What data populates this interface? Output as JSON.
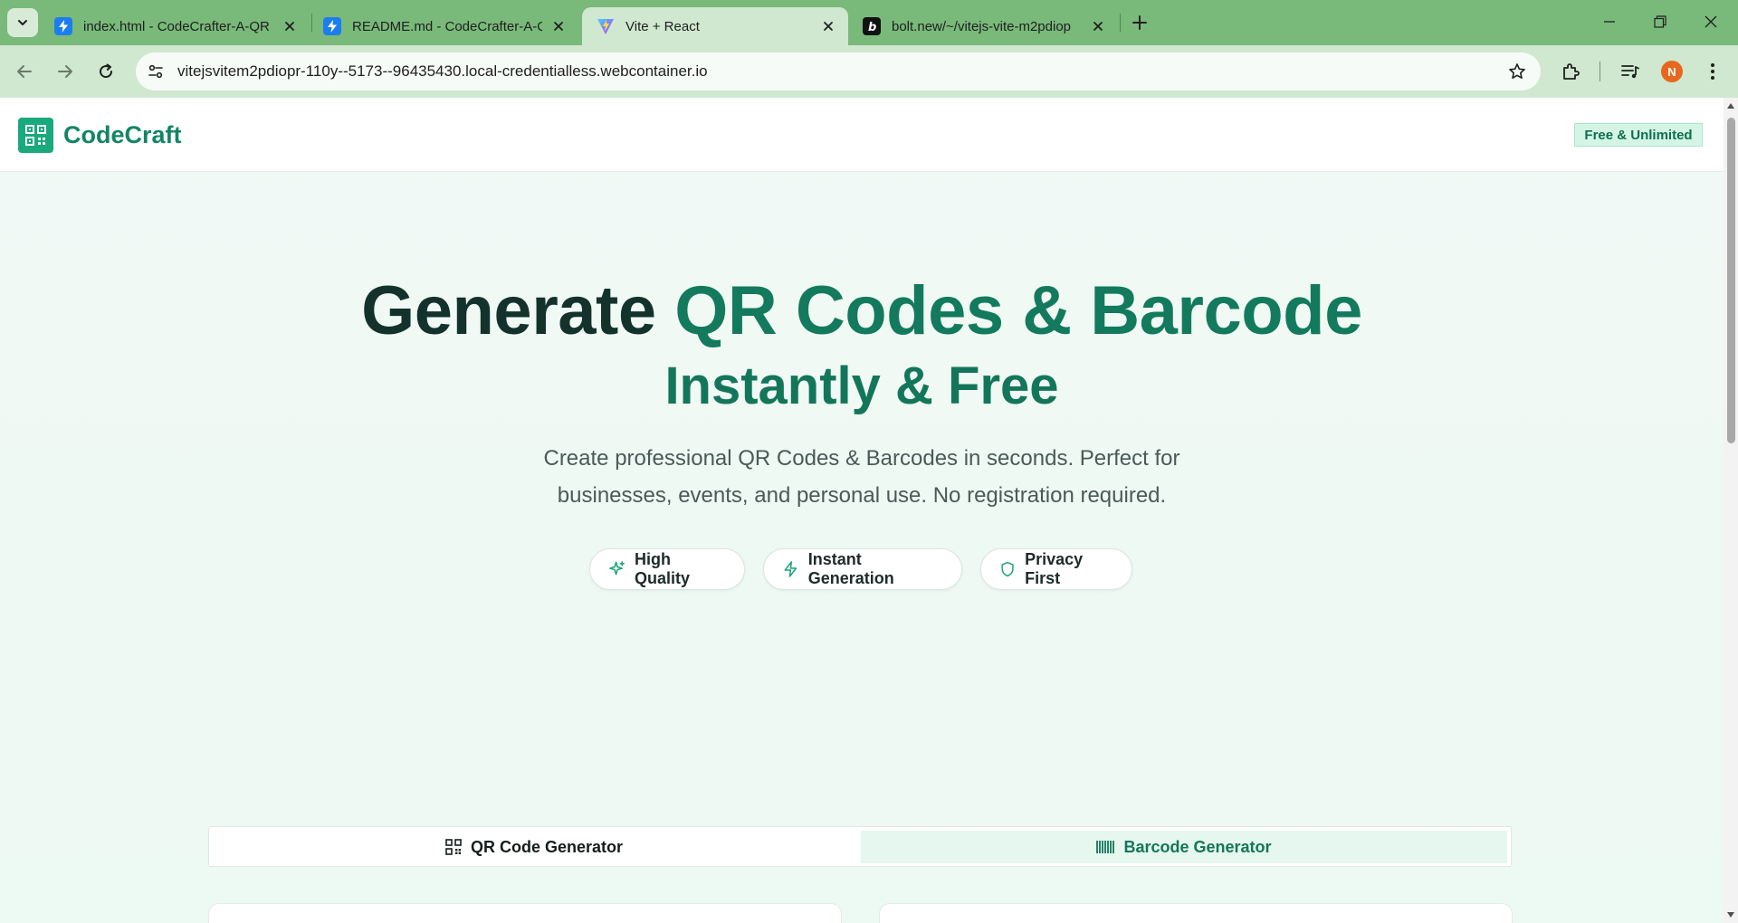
{
  "browser": {
    "tabs": [
      {
        "title": "index.html - CodeCrafter-A-QR",
        "icon": "bolt-icon",
        "active": false
      },
      {
        "title": "README.md - CodeCrafter-A-Q",
        "icon": "bolt-icon",
        "active": false
      },
      {
        "title": "Vite + React",
        "icon": "vite-icon",
        "active": true
      },
      {
        "title": "bolt.new/~/vitejs-vite-m2pdiop",
        "icon": "bolt-b-icon",
        "active": false
      }
    ],
    "url": "vitejsvitem2pdiopr-110y--5173--96435430.local-credentialless.webcontainer.io",
    "profile_initial": "N"
  },
  "site": {
    "brand": "CodeCraft",
    "badge": "Free & Unlimited"
  },
  "hero": {
    "title_part1": "Generate",
    "title_part2": "QR Codes & Barcode",
    "title_line2": "Instantly & Free",
    "subtitle": "Create professional QR Codes & Barcodes in seconds. Perfect for businesses, events, and personal use. No registration required."
  },
  "features": [
    {
      "label": "High Quality",
      "icon": "sparkles-icon"
    },
    {
      "label": "Instant Generation",
      "icon": "zap-icon"
    },
    {
      "label": "Privacy First",
      "icon": "shield-icon"
    }
  ],
  "generator_tabs": [
    {
      "label": "QR Code Generator",
      "icon": "qr-code-icon",
      "active": true
    },
    {
      "label": "Barcode Generator",
      "icon": "barcode-icon",
      "active": false
    }
  ],
  "colors": {
    "brand": "#1aa97d",
    "accent_text": "#137a5d",
    "tabstrip": "#79b97a",
    "toolbar": "#cfe8cf",
    "avatar": "#e8671f"
  }
}
